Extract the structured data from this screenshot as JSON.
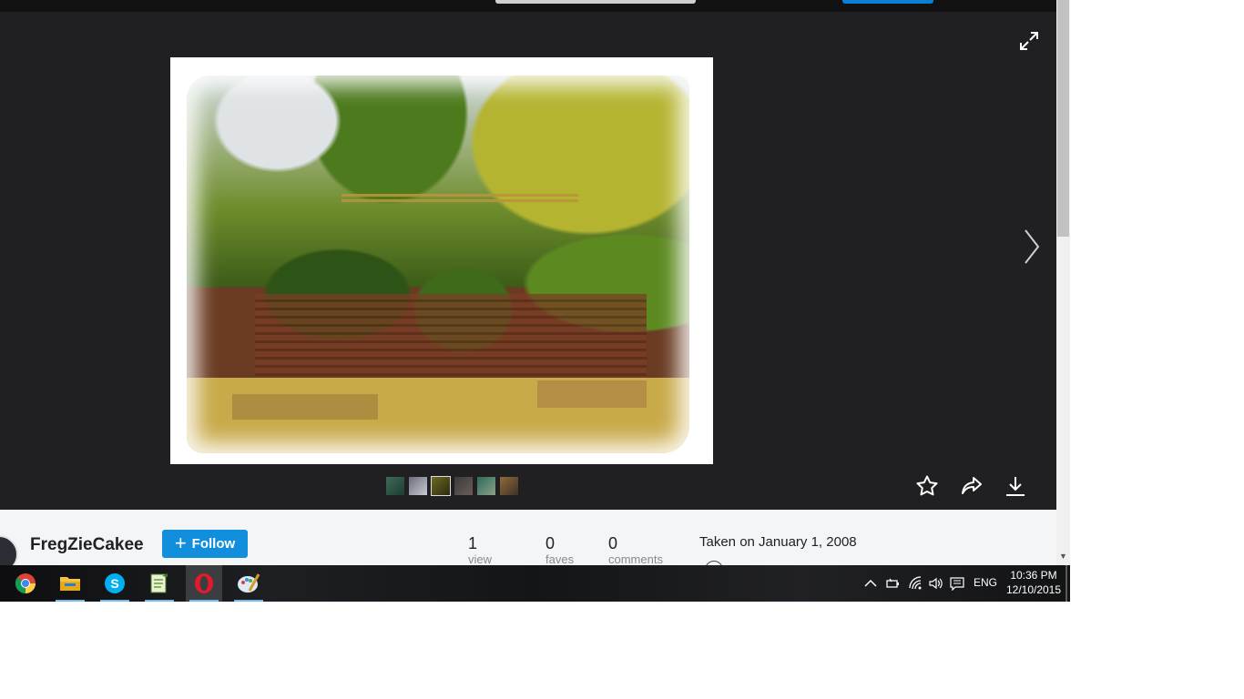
{
  "user": {
    "name": "FregZieCakee",
    "follow_label": "Follow"
  },
  "stats": {
    "views": {
      "value": "1",
      "label": "view"
    },
    "faves": {
      "value": "0",
      "label": "faves"
    },
    "comments": {
      "value": "0",
      "label": "comments"
    }
  },
  "taken": "Taken on January 1, 2008",
  "thumbnails": [
    "thumb-1",
    "thumb-2",
    "thumb-3",
    "thumb-4",
    "thumb-5",
    "thumb-6"
  ],
  "taskbar": {
    "apps": [
      "chrome-icon",
      "file-explorer-icon",
      "skype-icon",
      "notepad-icon",
      "opera-icon",
      "paint-icon"
    ],
    "language": "ENG",
    "time": "10:36 PM",
    "date": "12/10/2015"
  },
  "colors": {
    "viewer_bg": "#202022",
    "follow_blue": "#128fdc",
    "info_bg": "#f3f5f6"
  }
}
